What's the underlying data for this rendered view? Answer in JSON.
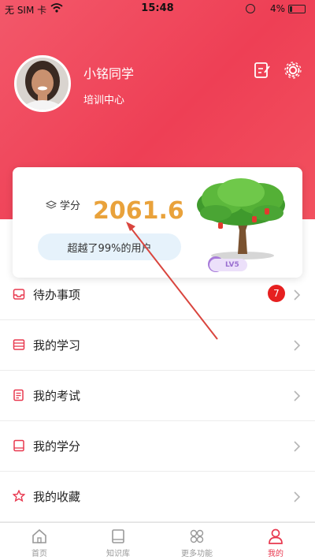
{
  "status_bar": {
    "carrier": "无 SIM 卡",
    "time": "15:48",
    "battery": "4%"
  },
  "profile": {
    "name": "小铭同学",
    "org": "培训中心",
    "icons": [
      "edit-icon",
      "gear-icon"
    ]
  },
  "score_card": {
    "label": "学分",
    "value": "2061.6",
    "beat_text": "超越了99%的用户",
    "level": "LV5"
  },
  "menu": {
    "items": [
      {
        "label": "待办事项",
        "icon": "inbox-icon",
        "badge": "7"
      },
      {
        "label": "我的学习",
        "icon": "list-icon"
      },
      {
        "label": "我的考试",
        "icon": "doc-icon"
      },
      {
        "label": "我的学分",
        "icon": "book-icon"
      },
      {
        "label": "我的收藏",
        "icon": "star-icon"
      }
    ]
  },
  "tab_bar": {
    "tabs": [
      {
        "label": "首页",
        "icon": "home-icon"
      },
      {
        "label": "知识库",
        "icon": "library-icon"
      },
      {
        "label": "更多功能",
        "icon": "grid-icon"
      },
      {
        "label": "我的",
        "icon": "person-icon",
        "active": true
      }
    ]
  },
  "colors": {
    "accent": "#ee3f55",
    "credit": "#e9a23b",
    "menu_icon": "#e8384f"
  }
}
